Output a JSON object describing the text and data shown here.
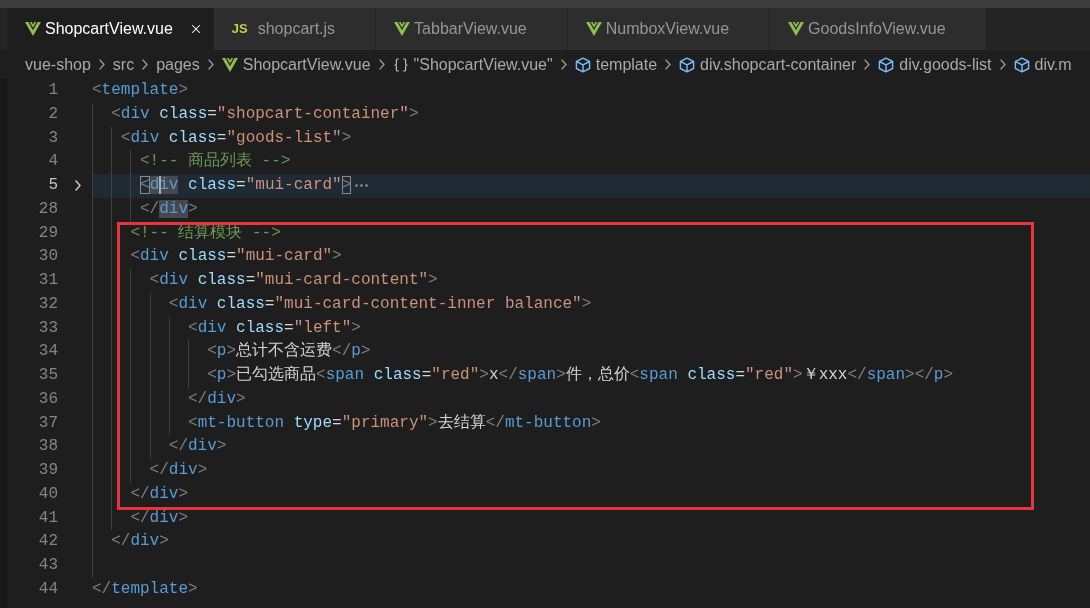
{
  "tabs": [
    {
      "label": "ShopcartView.vue",
      "kind": "vue",
      "selected": true
    },
    {
      "label": "shopcart.js",
      "kind": "js",
      "icon_label": "JS",
      "selected": false
    },
    {
      "label": "TabbarView.vue",
      "kind": "vue",
      "selected": false
    },
    {
      "label": "NumboxView.vue",
      "kind": "vue",
      "selected": false
    },
    {
      "label": "GoodsInfoView.vue",
      "kind": "vue",
      "selected": false
    }
  ],
  "breadcrumb": [
    {
      "label": "vue-shop",
      "kind": "folder"
    },
    {
      "label": "src",
      "kind": "folder"
    },
    {
      "label": "pages",
      "kind": "folder"
    },
    {
      "label": "ShopcartView.vue",
      "kind": "vue"
    },
    {
      "label": "\"ShopcartView.vue\"",
      "kind": "module"
    },
    {
      "label": "template",
      "kind": "element"
    },
    {
      "label": "div.shopcart-container",
      "kind": "element"
    },
    {
      "label": "div.goods-list",
      "kind": "element"
    },
    {
      "label": "div.m",
      "kind": "element"
    }
  ],
  "editor": {
    "lines": [
      {
        "number": "1",
        "kind": "code",
        "text": "<template>",
        "current": false,
        "folded": false,
        "tag_match": false
      },
      {
        "number": "2",
        "kind": "code",
        "text": "  <div class=\"shopcart-container\">",
        "current": false,
        "folded": false,
        "tag_match": false
      },
      {
        "number": "3",
        "kind": "code",
        "text": "   <div class=\"goods-list\">",
        "current": false,
        "folded": false,
        "tag_match": false
      },
      {
        "number": "4",
        "kind": "comment",
        "text": "     <!-- 商品列表 -->",
        "current": false,
        "folded": false
      },
      {
        "number": "5",
        "kind": "code",
        "text": "     <div class=\"mui-card\">",
        "current": true,
        "folded": true,
        "tag_match": true
      },
      {
        "number": "28",
        "kind": "code",
        "text": "     </div>",
        "current": false,
        "folded": false,
        "tag_match": true
      }
    ],
    "annotation_box": {
      "lines": [
        {
          "number": "29",
          "kind": "comment",
          "text": "    <!-- 结算模块 -->",
          "current": false,
          "folded": false
        },
        {
          "number": "30",
          "kind": "code",
          "text": "    <div class=\"mui-card\">",
          "current": false,
          "folded": false,
          "tag_match": false
        },
        {
          "number": "31",
          "kind": "code",
          "text": "      <div class=\"mui-card-content\">",
          "current": false,
          "folded": false,
          "tag_match": false
        },
        {
          "number": "32",
          "kind": "code",
          "text": "        <div class=\"mui-card-content-inner balance\">",
          "current": false,
          "folded": false,
          "tag_match": false
        },
        {
          "number": "33",
          "kind": "code",
          "text": "          <div class=\"left\">",
          "current": false,
          "folded": false,
          "tag_match": false
        },
        {
          "number": "34",
          "kind": "code",
          "text": "            <p>总计不含运费</p>",
          "current": false,
          "folded": false,
          "tag_match": false
        },
        {
          "number": "35",
          "kind": "code",
          "text": "            <p>已勾选商品<span class=\"red\">x</span>件，总价<span class=\"red\">￥xxx</span></p>",
          "current": false,
          "folded": false,
          "tag_match": false
        },
        {
          "number": "36",
          "kind": "code",
          "text": "          </div>",
          "current": false,
          "folded": false,
          "tag_match": false
        },
        {
          "number": "37",
          "kind": "code",
          "text": "          <mt-button type=\"primary\">去结算</mt-button>",
          "current": false,
          "folded": false,
          "tag_match": false
        },
        {
          "number": "38",
          "kind": "code",
          "text": "        </div>",
          "current": false,
          "folded": false,
          "tag_match": false
        },
        {
          "number": "39",
          "kind": "code",
          "text": "      </div>",
          "current": false,
          "folded": false,
          "tag_match": false
        },
        {
          "number": "40",
          "kind": "code",
          "text": "    </div>",
          "current": false,
          "folded": false,
          "tag_match": false
        }
      ]
    },
    "lines_after": [
      {
        "number": "41",
        "kind": "code",
        "text": "    </div>",
        "current": false,
        "folded": false,
        "tag_match": false
      },
      {
        "number": "42",
        "kind": "code",
        "text": "  </div>",
        "current": false,
        "folded": false,
        "tag_match": false
      },
      {
        "number": "43",
        "kind": "blank",
        "current": false,
        "folded": false
      },
      {
        "number": "44",
        "kind": "code",
        "text": "</template>",
        "current": false,
        "folded": false,
        "tag_match": false
      }
    ]
  }
}
